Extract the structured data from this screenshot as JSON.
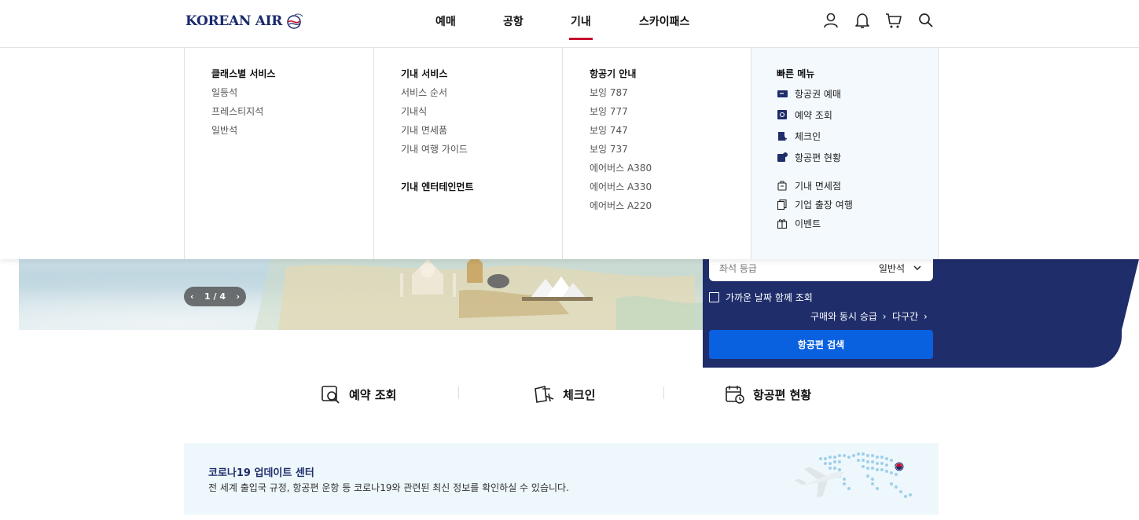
{
  "brand": {
    "logo_text": "KOREAN AIR"
  },
  "nav": {
    "items": [
      "예매",
      "공항",
      "기내",
      "스카이패스"
    ],
    "active": "기내"
  },
  "util_icons": [
    "user-icon",
    "bell-icon",
    "cart-icon",
    "search-icon"
  ],
  "mega_menu": {
    "class_service": {
      "title": "클래스별 서비스",
      "links": [
        "일등석",
        "프레스티지석",
        "일반석"
      ]
    },
    "inflight_service": {
      "title": "기내 서비스",
      "links": [
        "서비스 순서",
        "기내식",
        "기내 면세품",
        "기내 여행 가이드"
      ],
      "highlighted": "기내식"
    },
    "entertainment": {
      "title": "기내 엔터테인먼트"
    },
    "aircraft": {
      "title": "항공기 안내",
      "links": [
        "보잉 787",
        "보잉 777",
        "보잉 747",
        "보잉 737",
        "에어버스 A380",
        "에어버스 A330",
        "에어버스 A220"
      ]
    },
    "quick_menu": {
      "title": "빠른 메뉴",
      "group1": [
        "항공권 예매",
        "예약 조회",
        "체크인",
        "항공편 현황"
      ],
      "group2": [
        "기내 면세점",
        "기업 출장 여행",
        "이벤트"
      ]
    }
  },
  "hero": {
    "pager": "1 / 4"
  },
  "booking": {
    "seat_label": "좌석 등급",
    "seat_value": "일반석",
    "nearby_dates": "가까운 날짜 함께 조회",
    "upgrade_link": "구매와 동시 승급",
    "multi_city_link": "다구간",
    "search_button": "항공편 검색"
  },
  "quick_actions": [
    "예약 조회",
    "체크인",
    "항공편 현황"
  ],
  "covid": {
    "title": "코로나19 업데이트 센터",
    "desc": "전 세계 출입국 규정, 항공편 운항 등 코로나19와 관련된 최신 정보를 확인하실 수 있습니다."
  },
  "colors": {
    "brand_navy": "#1f2d6b",
    "accent_red": "#c8102e",
    "button_blue": "#0a61e0",
    "annotation_blue": "#1c1ad4"
  }
}
